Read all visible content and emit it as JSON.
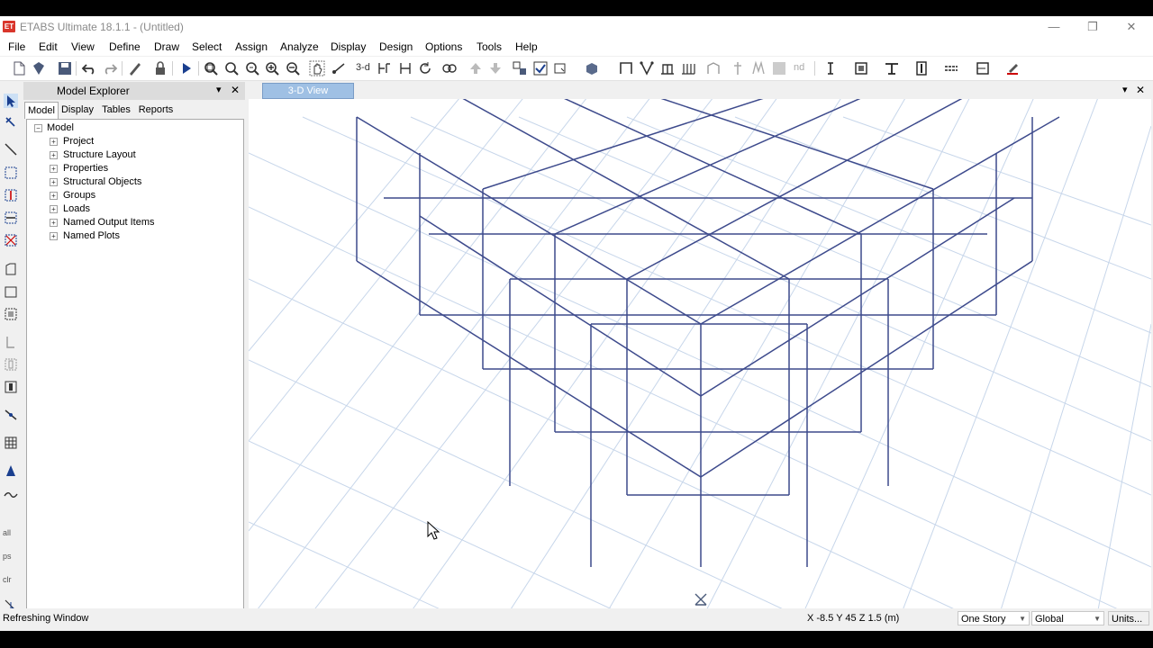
{
  "app": {
    "title": "ETABS Ultimate 18.1.1 - (Untitled)",
    "icon_label": "ET"
  },
  "window_controls": {
    "minimize": "—",
    "restore": "❐",
    "close": "✕"
  },
  "menu": [
    "File",
    "Edit",
    "View",
    "Define",
    "Draw",
    "Select",
    "Assign",
    "Analyze",
    "Display",
    "Design",
    "Options",
    "Tools",
    "Help"
  ],
  "toolbar": {
    "view_3d_label": "3-d",
    "nd_label": "nd"
  },
  "left_tools": {
    "labels": [
      "all",
      "ps",
      "clr"
    ]
  },
  "explorer": {
    "title": "Model Explorer",
    "pin_glyph": "▾",
    "close_glyph": "✕",
    "tabs": [
      "Model",
      "Display",
      "Tables",
      "Reports"
    ],
    "active_tab": "Model",
    "tree_root": "Model",
    "tree_items": [
      "Project",
      "Structure Layout",
      "Properties",
      "Structural Objects",
      "Groups",
      "Loads",
      "Named Output Items",
      "Named Plots"
    ]
  },
  "view": {
    "tab_label": "3-D View",
    "dropdown_glyph": "▾",
    "close_glyph": "✕"
  },
  "status": {
    "message": "Refreshing Window",
    "coordinates": "X -8.5  Y 45  Z 1.5 (m)",
    "story_select": "One Story",
    "coord_system": "Global",
    "units_button": "Units..."
  },
  "colors": {
    "frame": "#3d4a8c",
    "grid": "#c7d6ea",
    "view_tab": "#9fc0e4",
    "app_icon": "#d9352b"
  }
}
